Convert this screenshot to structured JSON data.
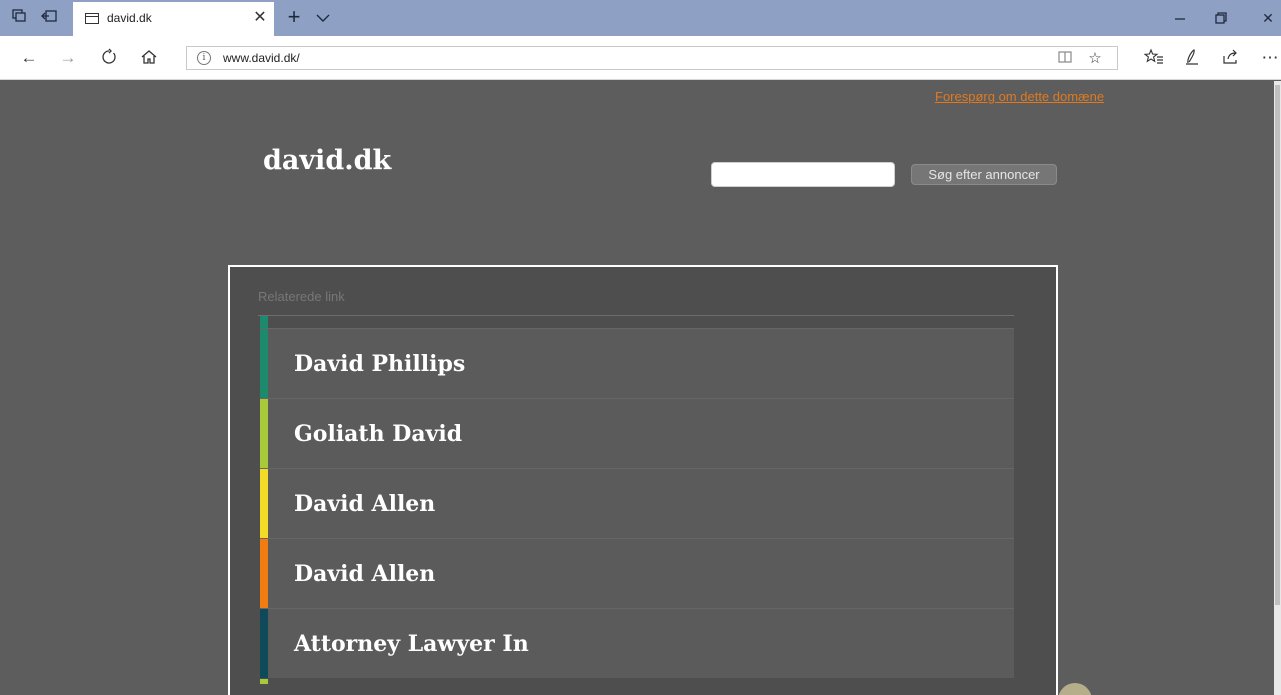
{
  "browser": {
    "tab": {
      "title": "david.dk"
    },
    "address": {
      "url": "www.david.dk/"
    }
  },
  "icons": {
    "tab_actions": "tab-actions-icon",
    "set_aside": "set-aside-tabs-icon",
    "favicon": "page-favicon-icon",
    "close_tab": "close-icon",
    "new_tab": "plus-icon",
    "tab_list": "chevron-down-icon",
    "minimize": "minimize-icon",
    "restore": "restore-icon",
    "close_window": "close-icon",
    "back": "back-arrow-icon",
    "forward": "forward-arrow-icon",
    "refresh": "refresh-icon",
    "home": "home-icon",
    "info": "info-icon",
    "reading_view": "book-icon",
    "favorite": "star-icon",
    "favorites_list": "favorites-list-icon",
    "notes": "pen-icon",
    "share": "share-icon",
    "more": "more-icon"
  },
  "page": {
    "inquire_link": "Forespørg om dette domæne",
    "site_title": "david.dk",
    "search": {
      "value": "",
      "placeholder": "",
      "button_label": "Søg efter annoncer"
    },
    "related_label": "Relaterede link",
    "links": [
      {
        "label": "David Phillips",
        "accent": "#1d8a6e"
      },
      {
        "label": "Goliath David",
        "accent": "#a8c93a"
      },
      {
        "label": "David Allen",
        "accent": "#f2dc28"
      },
      {
        "label": "David Allen",
        "accent": "#f27c10"
      },
      {
        "label": "Attorney Lawyer In",
        "accent": "#0e4a5a"
      }
    ],
    "top_accent": "#1d8a6e",
    "bottom_accent": "#a8c93a",
    "link_color": "#e07a1f"
  }
}
